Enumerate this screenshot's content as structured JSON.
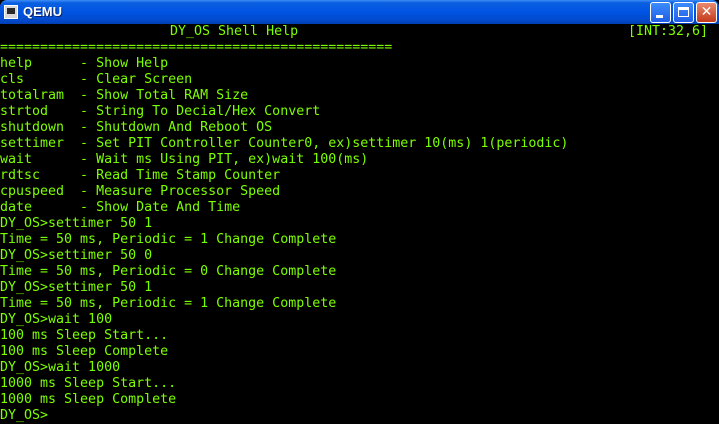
{
  "window": {
    "title": "QEMU",
    "app_icon": "qemu-app-icon",
    "controls": {
      "minimize": "minimize-icon",
      "maximize": "maximize-icon",
      "close": "✕"
    }
  },
  "colors": {
    "console_text": "#7dff00",
    "console_bg": "#000000",
    "titlebar": "#0054e3"
  },
  "header": {
    "title": "DY_OS Shell Help",
    "interrupt": "[INT:32,6]",
    "separator": "================================================="
  },
  "help_lines": [
    "help      - Show Help",
    "cls       - Clear Screen",
    "totalram  - Show Total RAM Size",
    "strtod    - String To Decial/Hex Convert",
    "shutdown  - Shutdown And Reboot OS",
    "settimer  - Set PIT Controller Counter0, ex)settimer 10(ms) 1(periodic)",
    "wait      - Wait ms Using PIT, ex)wait 100(ms)",
    "rdtsc     - Read Time Stamp Counter",
    "cpuspeed  - Measure Processor Speed",
    "date      - Show Date And Time"
  ],
  "output_lines": [
    "DY_OS>settimer 50 1",
    "Time = 50 ms, Periodic = 1 Change Complete",
    "DY_OS>settimer 50 0",
    "Time = 50 ms, Periodic = 0 Change Complete",
    "DY_OS>settimer 50 1",
    "Time = 50 ms, Periodic = 1 Change Complete",
    "DY_OS>wait 100",
    "100 ms Sleep Start...",
    "100 ms Sleep Complete",
    "DY_OS>wait 1000",
    "1000 ms Sleep Start...",
    "1000 ms Sleep Complete",
    "DY_OS>"
  ]
}
